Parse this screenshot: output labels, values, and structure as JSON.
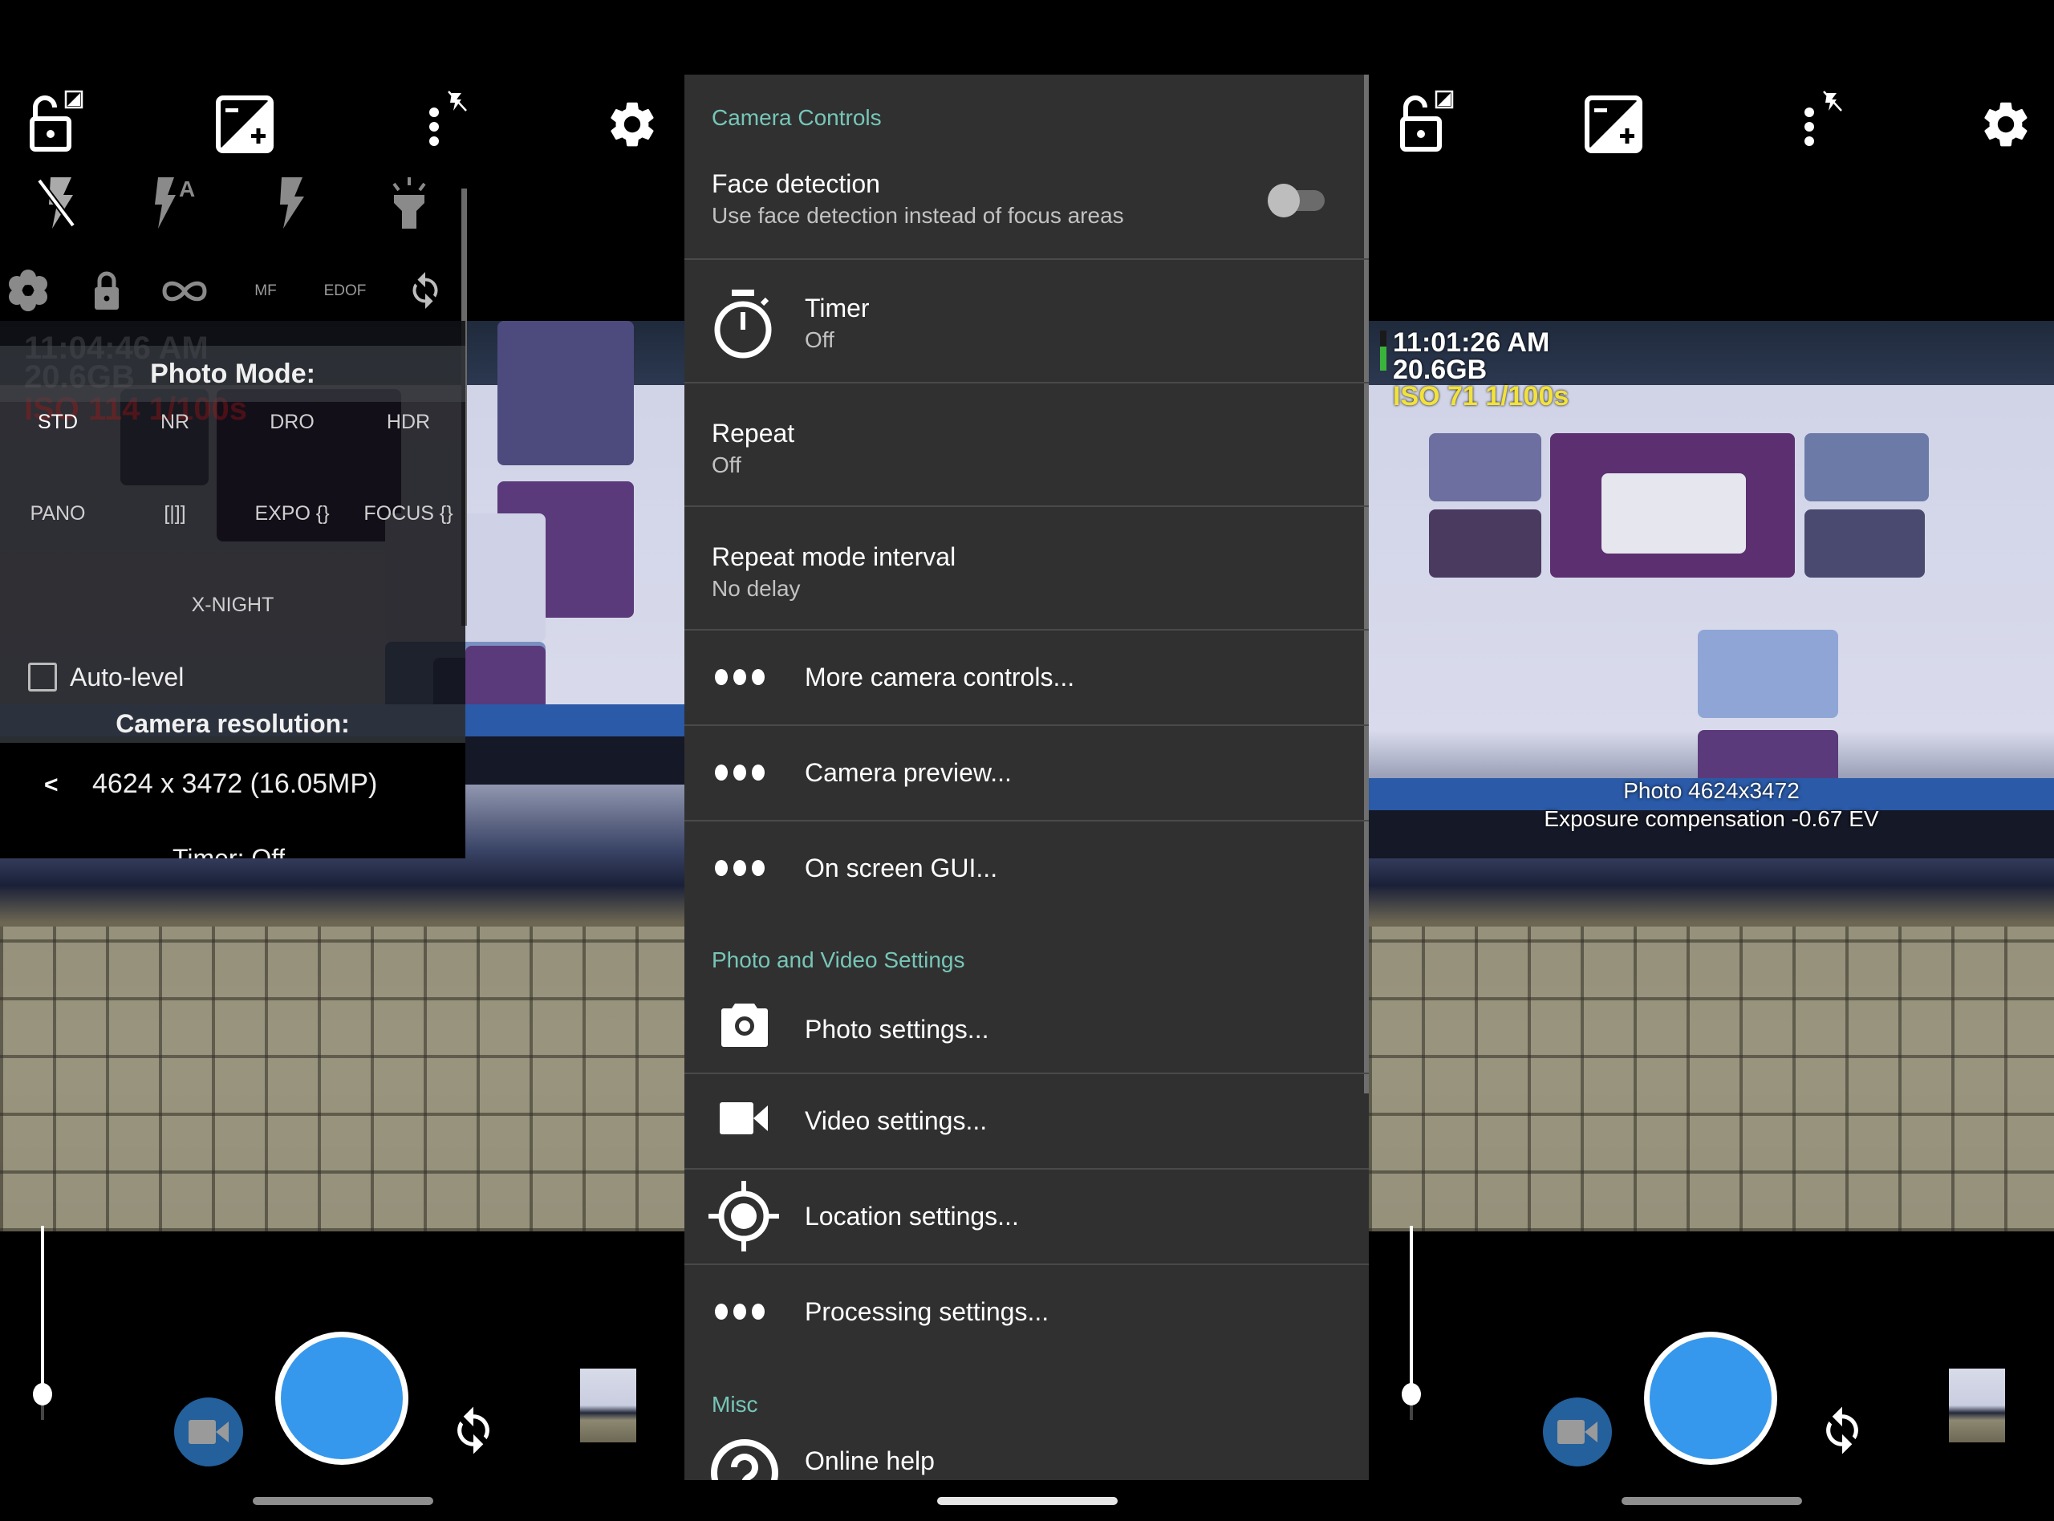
{
  "colors": {
    "accent_teal": "#76c6b8",
    "shutter_blue": "#3598ec",
    "video_button_blue": "#23609c",
    "menu_bg": "#303030",
    "hud_yellow": "#f2e23a",
    "battery_green": "#3bb33b"
  },
  "top_bar_icons": [
    "exposure-lock-icon",
    "exposure-compensation-icon",
    "popup-menu-icon",
    "settings-gear-icon"
  ],
  "left_panel": {
    "flash_icons": [
      "flash-off-icon",
      "flash-auto-icon",
      "flash-on-icon",
      "torch-icon"
    ],
    "control_row": {
      "white_balance_icon": "flower-icon",
      "lock_icon": "lock-icon",
      "infinity_icon": "infinity-icon",
      "mf_label": "MF",
      "edof_label": "EDOF",
      "switch_icon": "sync-icon"
    },
    "faded_hud": {
      "time": "11:04:46 AM",
      "storage": "20.6GB",
      "iso": "ISO 114 1/100s"
    },
    "photo_mode": {
      "title": "Photo Mode:",
      "modes": [
        "STD",
        "NR",
        "DRO",
        "HDR",
        "PANO",
        "[|]]",
        "EXPO {}",
        "FOCUS {}",
        "X-NIGHT"
      ],
      "selected": "STD"
    },
    "auto_level": {
      "label": "Auto-level",
      "checked": false
    },
    "camera_resolution": {
      "title": "Camera resolution:",
      "prev_arrow": "<",
      "value": "4624 x 3472 (16.05MP)"
    },
    "timer_partial": "Timer: Off",
    "zoom_level": 0.15
  },
  "settings_menu": {
    "sections": [
      {
        "title": "Camera Controls",
        "items": [
          {
            "title": "Face detection",
            "subtitle": "Use face detection instead of focus areas",
            "toggle": false
          },
          {
            "icon": "timer-icon",
            "title": "Timer",
            "subtitle": "Off"
          },
          {
            "title": "Repeat",
            "subtitle": "Off"
          },
          {
            "title": "Repeat mode interval",
            "subtitle": "No delay"
          },
          {
            "icon": "more-dots-icon",
            "title": "More camera controls..."
          },
          {
            "icon": "more-dots-icon",
            "title": "Camera preview..."
          },
          {
            "icon": "more-dots-icon",
            "title": "On screen GUI..."
          }
        ]
      },
      {
        "title": "Photo and Video Settings",
        "items": [
          {
            "icon": "camera-icon",
            "title": "Photo settings..."
          },
          {
            "icon": "video-camera-icon",
            "title": "Video settings..."
          },
          {
            "icon": "location-icon",
            "title": "Location settings..."
          },
          {
            "icon": "more-dots-icon",
            "title": "Processing settings..."
          }
        ]
      },
      {
        "title": "Misc",
        "items": [
          {
            "icon": "help-icon",
            "title": "Online help"
          }
        ]
      }
    ]
  },
  "right_panel": {
    "hud": {
      "time": "11:01:26 AM",
      "storage": "20.6GB",
      "iso_shutter": "ISO 71  1/100s"
    },
    "toast": {
      "line1": "Photo 4624x3472",
      "line2": "Exposure compensation -0.67 EV"
    },
    "battery_level": 0.6,
    "zoom_level": 0.15
  }
}
